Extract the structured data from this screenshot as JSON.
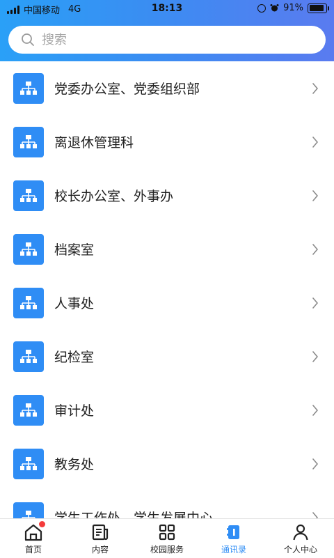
{
  "status_bar": {
    "carrier": "中国移动",
    "network": "4G",
    "time": "18:13",
    "battery": "91%"
  },
  "search": {
    "placeholder": "搜索"
  },
  "list": {
    "items": [
      {
        "label": "党委办公室、党委组织部"
      },
      {
        "label": "离退休管理科"
      },
      {
        "label": "校长办公室、外事办"
      },
      {
        "label": "档案室"
      },
      {
        "label": "人事处"
      },
      {
        "label": "纪检室"
      },
      {
        "label": "审计处"
      },
      {
        "label": "教务处"
      },
      {
        "label": "学生工作处、学生发展中心"
      }
    ]
  },
  "tabbar": {
    "tabs": [
      {
        "label": "首页",
        "icon": "home-icon"
      },
      {
        "label": "内容",
        "icon": "document-icon"
      },
      {
        "label": "校园服务",
        "icon": "grid-icon"
      },
      {
        "label": "通讯录",
        "icon": "contacts-icon"
      },
      {
        "label": "个人中心",
        "icon": "person-icon"
      }
    ],
    "active": "通讯录"
  },
  "colors": {
    "accent": "#2f8df5",
    "badge": "#f43b3b"
  }
}
